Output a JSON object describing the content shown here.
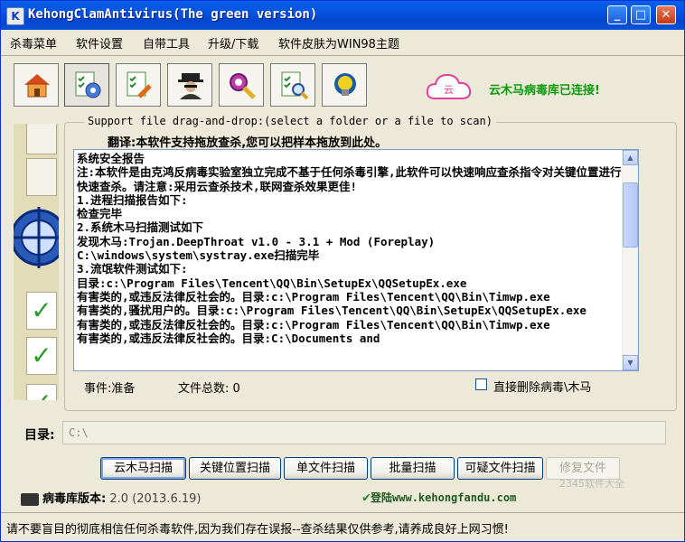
{
  "window": {
    "title": "KehongClamAntivirus(The green version)"
  },
  "menu": [
    "杀毒菜单",
    "软件设置",
    "自带工具",
    "升级/下载",
    "软件皮肤为WIN98主题"
  ],
  "toolbar": [
    {
      "icon": "home-icon"
    },
    {
      "icon": "checklist-target-icon"
    },
    {
      "icon": "checklist-wrench-icon"
    },
    {
      "icon": "spy-icon"
    },
    {
      "icon": "magnifier-gear-icon"
    },
    {
      "icon": "checklist-magnifier-icon"
    },
    {
      "icon": "bulb-shield-icon"
    }
  ],
  "cloud": {
    "badge": "云",
    "status": "云木马病毒库已连接!"
  },
  "scan": {
    "legend": "Support file drag-and-drop:(select a folder or a file to scan)",
    "note": "翻译:本软件支持拖放查杀,您可以把样本拖放到此处。"
  },
  "report": {
    "lines": [
      "系统安全报告",
      "注:本软件是由克鸿反病毒实验室独立完成不基于任何杀毒引擎,此软件可以快速响应查杀指令对关键位置进行快速查杀。请注意:采用云查杀技术,联网查杀效果更佳!",
      "1.进程扫描报告如下:",
      "检查完毕",
      "2.系统木马扫描测试如下",
      "发现木马:Trojan.DeepThroat v1.0 - 3.1 + Mod (Foreplay)",
      "C:\\windows\\system\\systray.exe扫描完毕",
      "3.流氓软件测试如下:",
      "目录:c:\\Program Files\\Tencent\\QQ\\Bin\\SetupEx\\QQSetupEx.exe",
      "有害类的,或违反法律反社会的。目录:c:\\Program Files\\Tencent\\QQ\\Bin\\Timwp.exe",
      "有害类的,骚扰用户的。目录:c:\\Program Files\\Tencent\\QQ\\Bin\\SetupEx\\QQSetupEx.exe",
      "有害类的,或违反法律反社会的。目录:c:\\Program Files\\Tencent\\QQ\\Bin\\Timwp.exe",
      "有害类的,或违反法律反社会的。目录:C:\\Documents and"
    ]
  },
  "status": {
    "event": "事件:准备",
    "file_count": "文件总数: 0",
    "auto_delete": "直接删除病毒\\木马"
  },
  "directory": {
    "label": "目录:",
    "value": "C:\\"
  },
  "buttons": {
    "cloud_scan": "云木马扫描",
    "key_scan": "关键位置扫描",
    "single_scan": "单文件扫描",
    "batch_scan": "批量扫描",
    "suspicious_scan": "可疑文件扫描",
    "repair": "修复文件"
  },
  "version": {
    "label": "病毒库版本:",
    "value": "2.0 (2013.6.19)"
  },
  "website": {
    "label": "登陆www.kehongfandu.com"
  },
  "watermark": "2345软件大全",
  "footer": "请不要盲目的彻底相信任何杀毒软件,因为我们存在误报--查杀结果仅供参考,请养成良好上网习惯!",
  "colors": {
    "title_bar": "#0553e1",
    "cloud_status": "#0a9a0a",
    "window_bg": "#ece9d8"
  }
}
